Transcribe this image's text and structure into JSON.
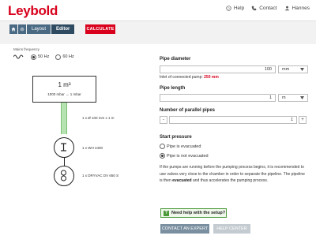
{
  "header": {
    "logo_text": "Leybold",
    "nav": [
      {
        "label": "Help",
        "icon": "help-icon"
      },
      {
        "label": "Contact",
        "icon": "phone-icon"
      },
      {
        "label": "Hannes",
        "icon": "user-icon"
      }
    ]
  },
  "breadcrumb": {
    "items": [
      {
        "icon": "home-icon"
      },
      {
        "icon": "gear-icon"
      },
      {
        "label": "Layout"
      },
      {
        "label": "Editor"
      }
    ],
    "calculate_label": "CALCULATE"
  },
  "diagram": {
    "mains_frequency_label": "Mains frequency",
    "freq_options": [
      {
        "label": "50 Hz",
        "selected": true
      },
      {
        "label": "60 Hz",
        "selected": false
      }
    ],
    "chamber_volume": "1 m³",
    "chamber_range": "1000 mbar → 1 mbar",
    "pipe_label": "1 x Ø 100 mm x 1 m",
    "pump1_label": "1 x WH 4400",
    "pump2_label": "1 x DRYVAC DV 650 S"
  },
  "form": {
    "pipe_diameter": {
      "label": "Pipe diameter",
      "value": "100",
      "unit": "mm",
      "hint_prefix": "Inlet of connected pump:",
      "hint_value": "250 mm"
    },
    "pipe_length": {
      "label": "Pipe length",
      "value": "1",
      "unit": "m"
    },
    "parallel_pipes": {
      "label": "Number of parallel pipes",
      "value": "1",
      "minus": "-",
      "plus": "+"
    },
    "start_pressure": {
      "label": "Start pressure",
      "options": [
        {
          "label": "Pipe is evacuated",
          "selected": false
        },
        {
          "label": "Pipe is not evacuated",
          "selected": true
        }
      ]
    },
    "info_before": "If the pumps are running before the pumping process begins, it is recommended to use valves very close to the chamber in order to separate the pipeline. The pipeline is then ",
    "info_bold": "evacuated",
    "info_after": " and thus accelerates the pumping process."
  },
  "help": {
    "box_label": "Need help with the setup?",
    "contact_label": "CONTACT AN EXPERT",
    "helpcenter_label": "HELP CENTER"
  },
  "colors": {
    "brand_red": "#d8001c",
    "crumb_blue": "#4a6a84",
    "pipe_green": "#b7e3b2"
  }
}
